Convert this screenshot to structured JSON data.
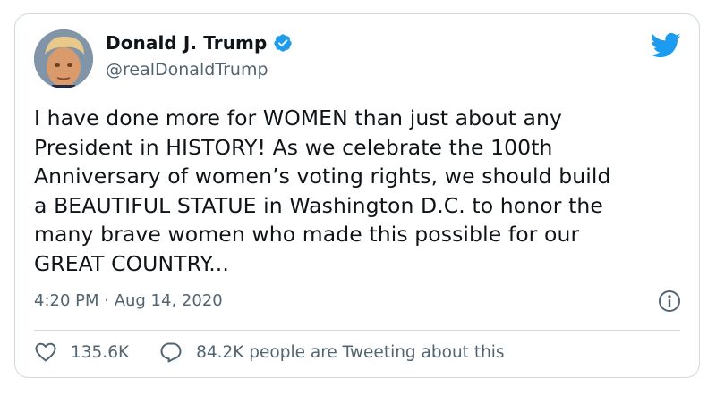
{
  "tweet": {
    "author": {
      "name": "Donald J. Trump",
      "handle": "@realDonaldTrump",
      "verified": true
    },
    "text": "I have done more for WOMEN than just about any\nPresident in HISTORY! As we celebrate the 100th\nAnniversary of women’s voting rights, we should build\na BEAUTIFUL STATUE in Washington D.C. to honor the\nmany brave women who made this possible for our\nGREAT COUNTRY...",
    "timestamp": "4:20 PM · Aug 14, 2020",
    "likes": "135.6K",
    "tweeting": "84.2K people are Tweeting about this"
  },
  "icons": {
    "brand": "twitter-bird-icon",
    "verified": "verified-badge-icon",
    "info": "info-icon",
    "like": "heart-icon",
    "reply": "speech-bubble-icon"
  },
  "colors": {
    "accent": "#1d9bf0",
    "text": "#0f1419",
    "muted": "#536471",
    "border": "#cfd9de"
  }
}
